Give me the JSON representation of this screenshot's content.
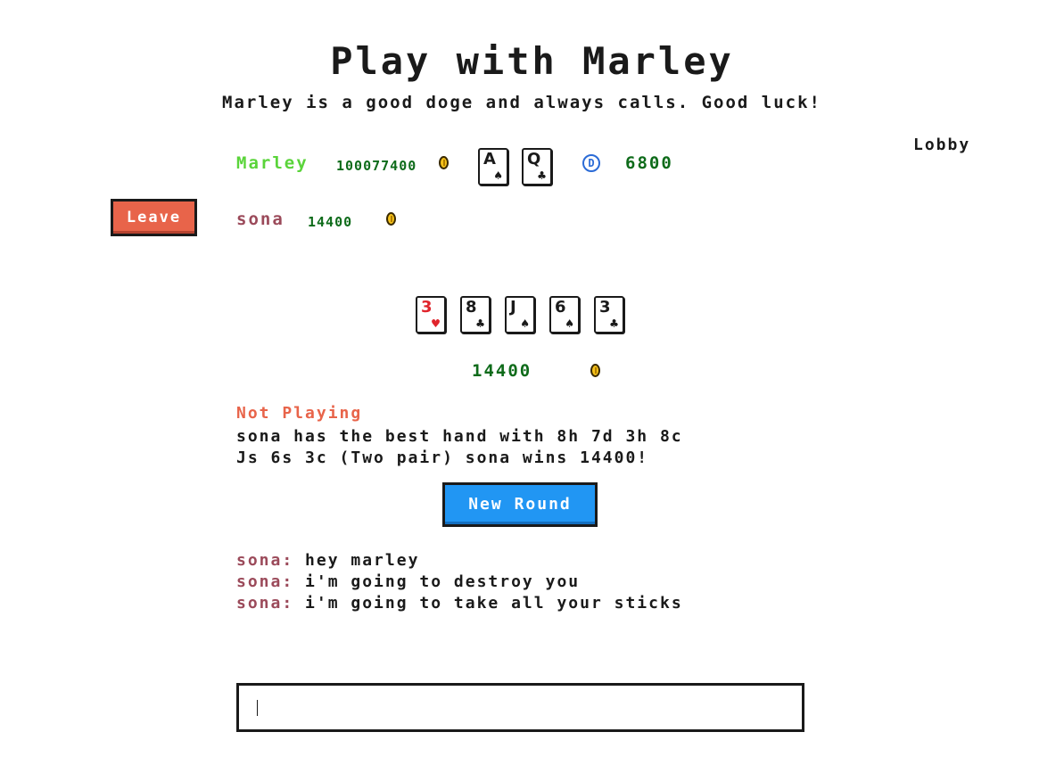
{
  "header": {
    "title": "Play with Marley",
    "subtitle": "Marley is a good doge and always calls. Good luck!",
    "lobby_link": "Lobby"
  },
  "players": [
    {
      "name": "Marley",
      "name_color": "#5ad43a",
      "chips": "100077400",
      "hole_cards": [
        {
          "rank": "A",
          "suit": "♠",
          "color": "#1a1a1a"
        },
        {
          "rank": "Q",
          "suit": "♣",
          "color": "#1a1a1a"
        }
      ],
      "dealer_badge": "D",
      "bet": "6800"
    },
    {
      "name": "sona",
      "name_color": "#9b4a5a",
      "chips": "14400"
    }
  ],
  "leave_button": "Leave",
  "board": [
    {
      "rank": "3",
      "suit": "♥",
      "color": "#e0242c"
    },
    {
      "rank": "8",
      "suit": "♣",
      "color": "#1a1a1a"
    },
    {
      "rank": "J",
      "suit": "♠",
      "color": "#1a1a1a"
    },
    {
      "rank": "6",
      "suit": "♠",
      "color": "#1a1a1a"
    },
    {
      "rank": "3",
      "suit": "♣",
      "color": "#1a1a1a"
    }
  ],
  "pot": "14400",
  "status": "Not Playing",
  "result_line1": "sona has the best hand with 8h 7d 3h 8c",
  "result_line2": "Js 6s 3c (Two pair) sona wins 14400!",
  "new_round_button": "New Round",
  "chat": [
    {
      "who": "sona:",
      "msg": "hey marley"
    },
    {
      "who": "sona:",
      "msg": "i'm going to destroy you"
    },
    {
      "who": "sona:",
      "msg": "i'm going to take all your sticks"
    }
  ],
  "chat_input": {
    "value": "",
    "placeholder": ""
  },
  "colors": {
    "accent_red": "#e8644a",
    "accent_blue": "#2196f3",
    "chip_green": "#0e6b1a"
  }
}
